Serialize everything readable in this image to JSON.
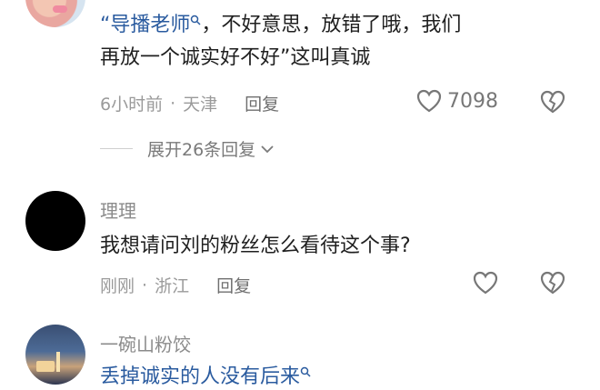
{
  "comments": [
    {
      "username": "",
      "mention": "“导播老师",
      "text_rest_line1": "，不好意思，放错了哦，我们",
      "text_line2": "再放一个诚实好不好”这叫真诚",
      "time": "6小时前",
      "location": "天津",
      "reply_label": "回复",
      "likes": "7098"
    },
    {
      "username": "理理",
      "text": "我想请问刘的粉丝怎么看待这个事?",
      "time": "刚刚",
      "location": "浙江",
      "reply_label": "回复",
      "likes": ""
    },
    {
      "username": "一碗山粉饺",
      "text": "丢掉诚实的人没有后来",
      "time": "",
      "location": "",
      "reply_label": "",
      "likes": ""
    }
  ],
  "expand_replies": "展开26条回复",
  "colors": {
    "link": "#2a5b9f",
    "muted": "#9a9a9a"
  },
  "icons": [
    "heart-icon",
    "broken-heart-icon",
    "search-icon",
    "chevron-down-icon"
  ]
}
